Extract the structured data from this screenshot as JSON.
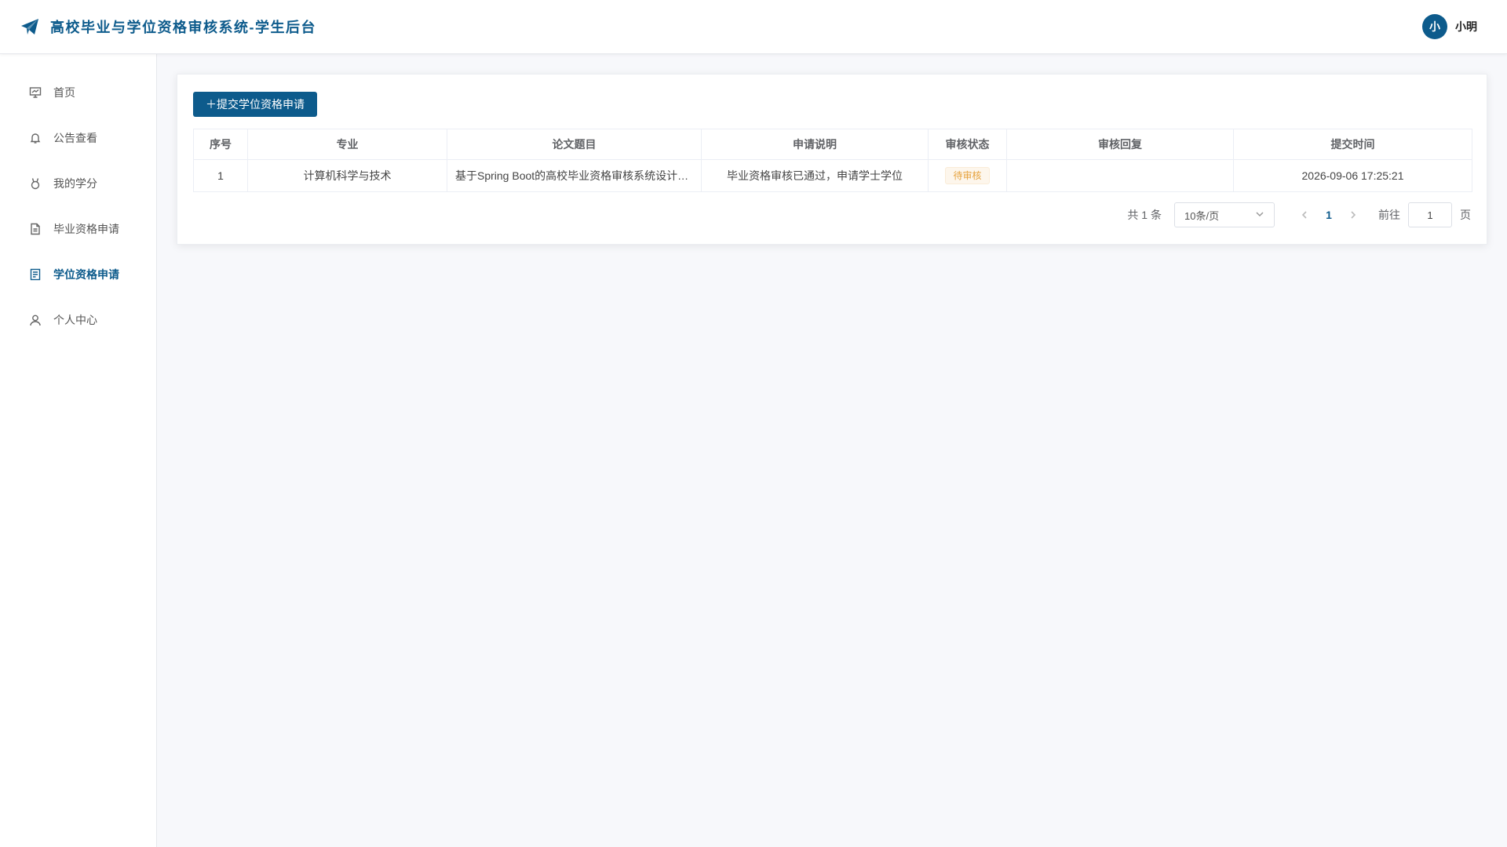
{
  "header": {
    "title": "高校毕业与学位资格审核系统-学生后台",
    "logo_icon": "paper-plane-icon",
    "user": {
      "avatar_text": "小",
      "name": "小明"
    },
    "brand_color": "#0d5b8c"
  },
  "sidebar": {
    "items": [
      {
        "label": "首页",
        "icon": "presentation-icon",
        "active": false
      },
      {
        "label": "公告查看",
        "icon": "bell-icon",
        "active": false
      },
      {
        "label": "我的学分",
        "icon": "medal-icon",
        "active": false
      },
      {
        "label": "毕业资格申请",
        "icon": "document-icon",
        "active": false
      },
      {
        "label": "学位资格申请",
        "icon": "list-document-icon",
        "active": true
      },
      {
        "label": "个人中心",
        "icon": "user-icon",
        "active": false
      }
    ]
  },
  "main": {
    "submit_button": "＋提交学位资格申请",
    "table": {
      "columns": [
        "序号",
        "专业",
        "论文题目",
        "申请说明",
        "审核状态",
        "审核回复",
        "提交时间"
      ],
      "rows": [
        {
          "index": "1",
          "major": "计算机科学与技术",
          "thesis": "基于Spring Boot的高校毕业资格审核系统设计与实现",
          "note": "毕业资格审核已通过，申请学士学位",
          "status": "待审核",
          "reply": "",
          "time": "2026-09-06 17:25:21"
        }
      ]
    },
    "pagination": {
      "total_text": "共 1 条",
      "page_size": "10条/页",
      "current_page": "1",
      "goto_label": "前往",
      "goto_value": "1",
      "goto_suffix": "页"
    }
  }
}
